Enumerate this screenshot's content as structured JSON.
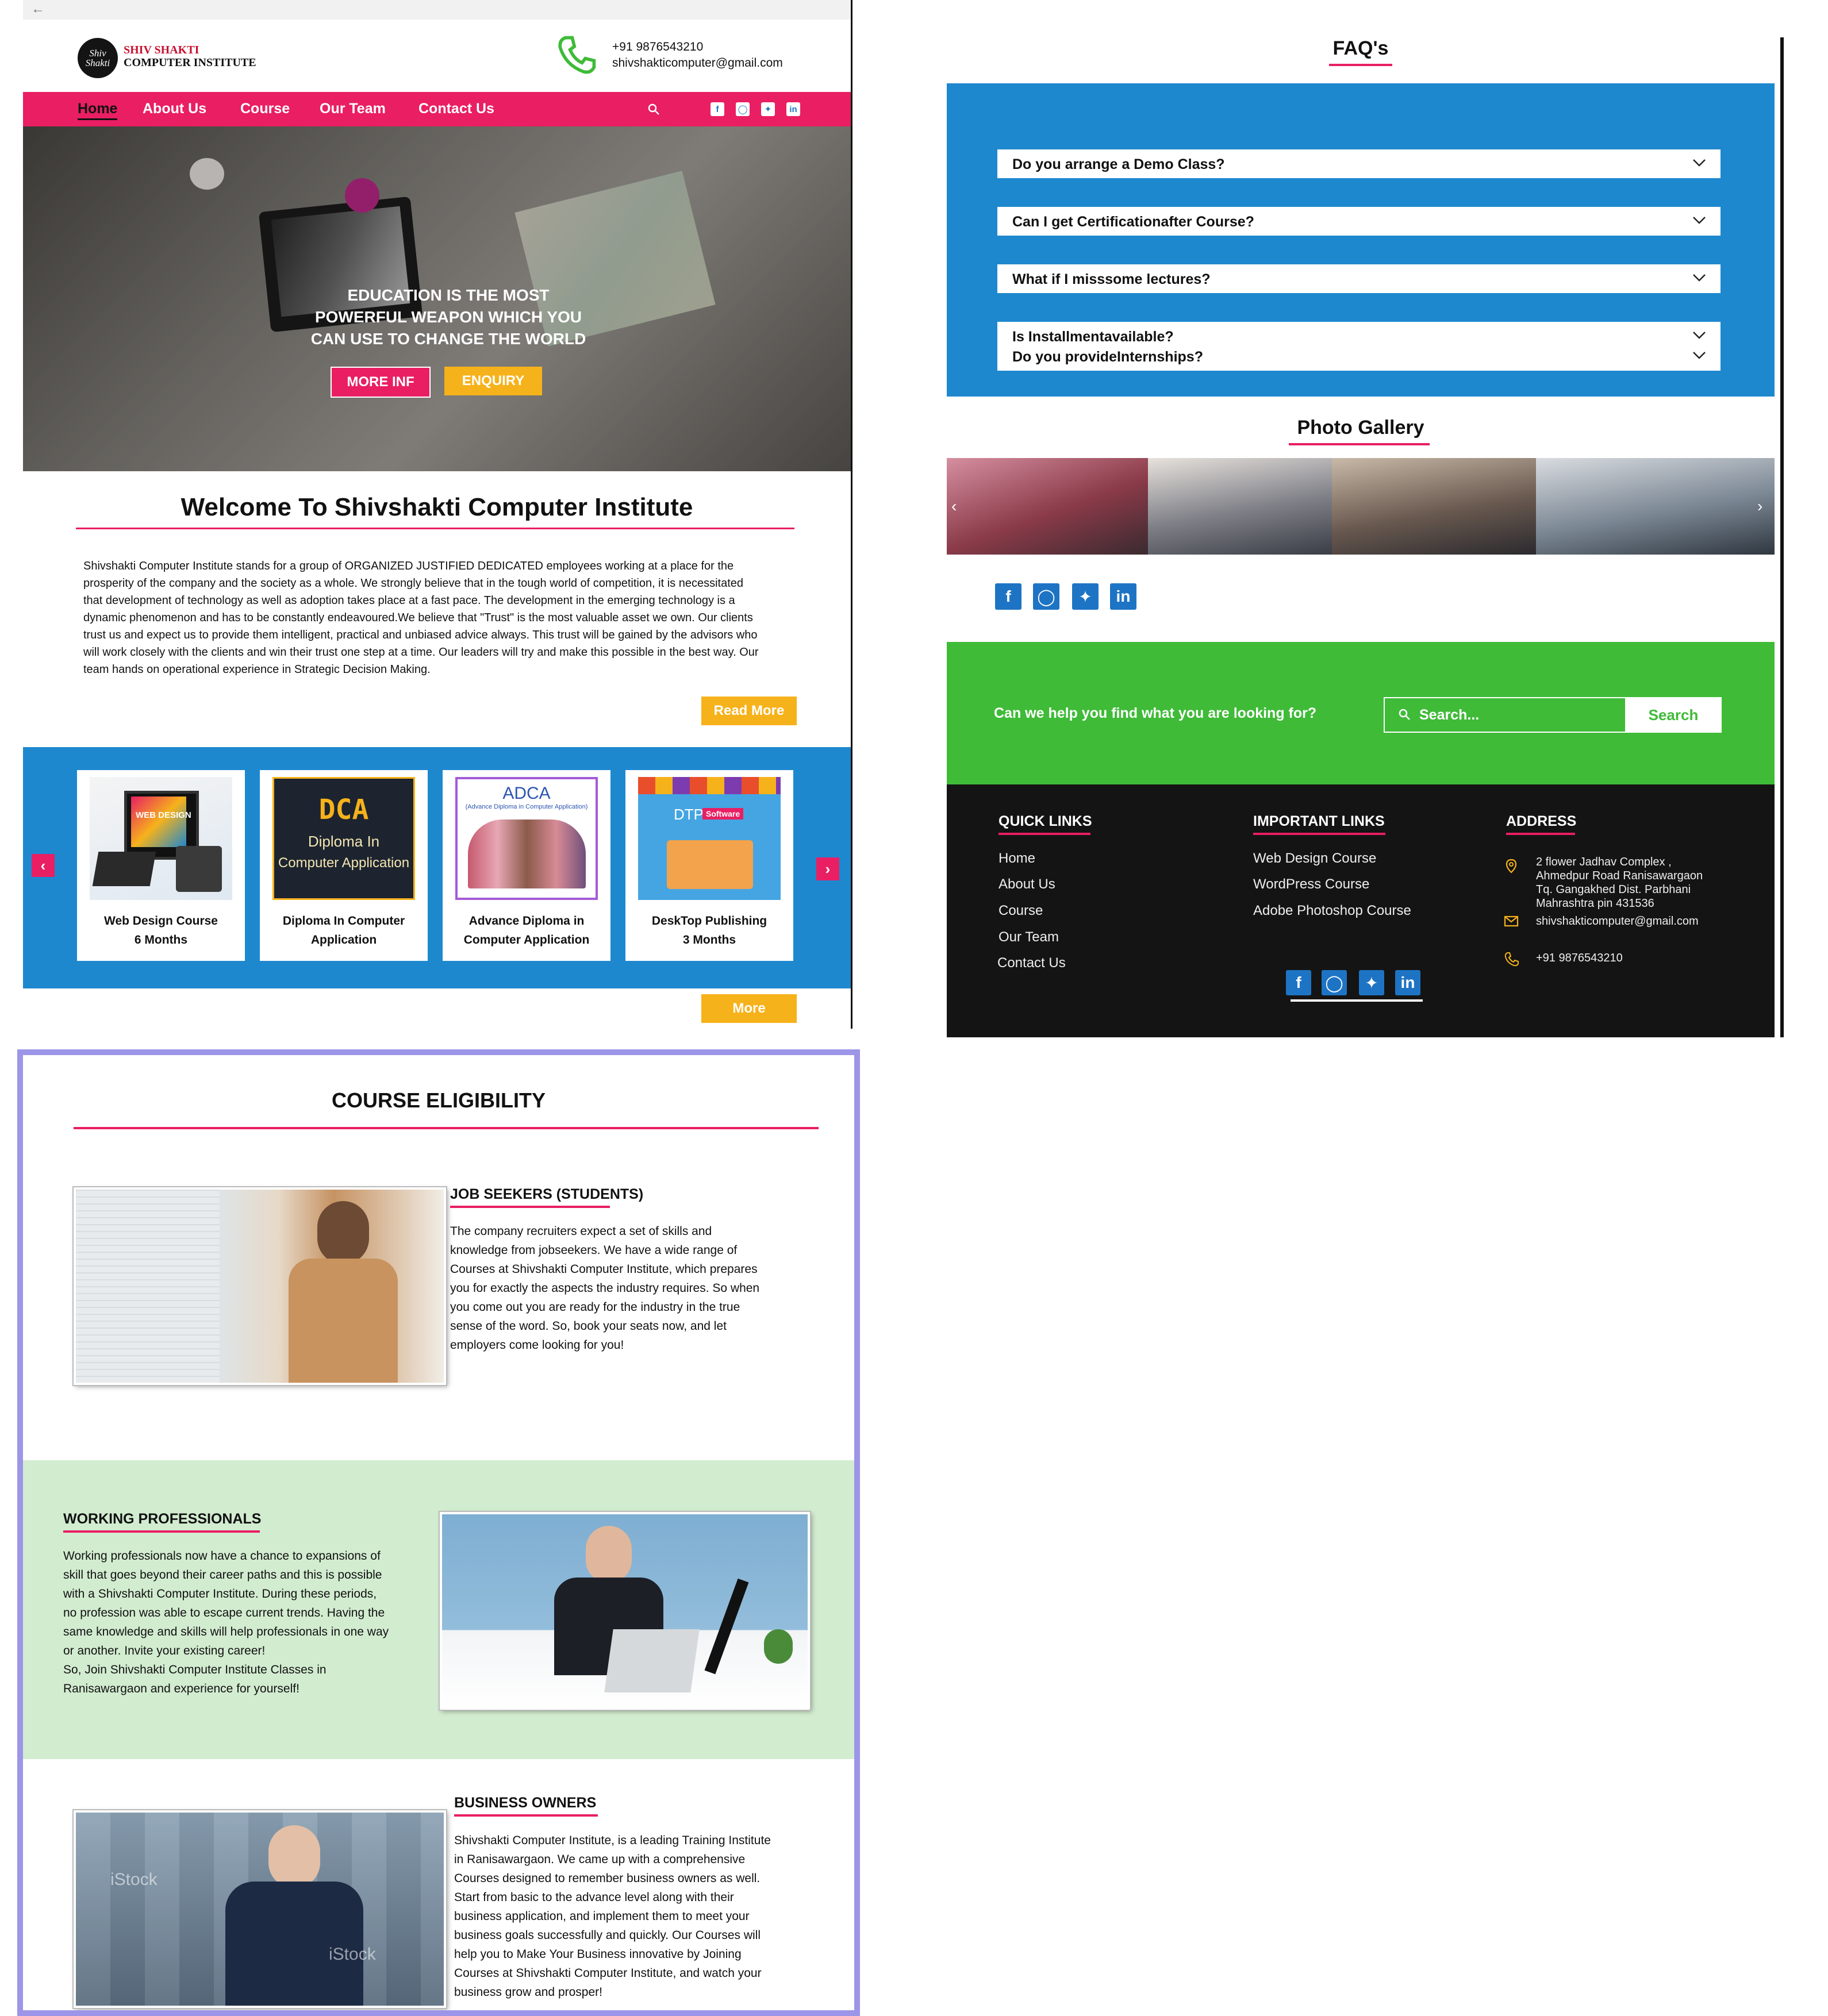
{
  "home": {
    "logo": {
      "line1": "SHIV SHAKTI",
      "line2": "COMPUTER INSTITUTE",
      "mark": "Shiv Shakti"
    },
    "contact": {
      "phone": "+91 9876543210",
      "email": "shivshakticomputer@gmail.com"
    },
    "nav": [
      "Home",
      "About Us",
      "Course",
      "Our Team",
      "Contact Us"
    ],
    "social": [
      "facebook-icon",
      "instagram-icon",
      "twitter-icon",
      "linkedin-icon"
    ],
    "hero": {
      "line1": "EDUCATION IS THE MOST",
      "line2": "POWERFUL WEAPON WHICH YOU",
      "line3": "CAN USE TO CHANGE THE WORLD",
      "btn_more": "MORE INF",
      "btn_enquiry": "ENQUIRY"
    },
    "welcome": {
      "title": "Welcome To  Shivshakti Computer Institute",
      "text": "Shivshakti Computer Institute stands for a group of ORGANIZED JUSTIFIED DEDICATED employees working at a place for the prosperity of the company and the society as a whole. We strongly believe that in the tough world of competition, it is necessitated that development of technology as well as adoption takes place at a fast pace. The development in the emerging technology is a dynamic phenomenon and has to be constantly endeavoured.We believe that \"Trust\" is the most valuable asset we own. Our clients trust us and expect us to provide them intelligent, practical and unbiased advice always. This trust will be gained by the advisors who will work closely with the clients and win their trust one step at a time. Our leaders will try and make this possible in the best way. Our team hands on operational experience in Strategic Decision Making.",
      "read_more": "Read More"
    },
    "courses": [
      {
        "line1": "Web Design Course",
        "line2": "6 Months",
        "img": "WEB DESIGN"
      },
      {
        "line1": "Diploma In Computer",
        "line2": "Application",
        "img1": "DCA",
        "img2": "Diploma In",
        "img3": "Computer Application"
      },
      {
        "line1": "Advance Diploma in",
        "line2": "Computer Application",
        "img1": "ADCA",
        "img2": "(Advance Diploma in Computer Application)"
      },
      {
        "line1": "DeskTop Publishing",
        "line2": "3 Months",
        "img1": "DTP",
        "img2": "Software"
      }
    ],
    "more_btn": "More"
  },
  "faq": {
    "title": "FAQ's",
    "items": [
      "Do you arrange a Demo Class?",
      "Can I get Certificationafter Course?",
      "What if I misssome lectures?",
      "Is Installmentavailable?",
      "Do you provideInternships?"
    ],
    "gallery_title": "Photo Gallery",
    "help_text": "Can we help you find what you are looking for?",
    "search_placeholder": "Search...",
    "search_btn": "Search",
    "footer": {
      "quick_title": "QUICK LINKS",
      "quick": [
        "Home",
        "About Us",
        "Course",
        "Our Team",
        "Contact Us"
      ],
      "important_title": "IMPORTANT LINKS",
      "important": [
        "Web Design Course",
        "WordPress Course",
        "Adobe Photoshop Course"
      ],
      "address_title": "ADDRESS",
      "address": [
        "2 flower Jadhav Complex ,",
        "Ahmedpur Road Ranisawargaon",
        "Tq. Gangakhed Dist. Parbhani",
        "Mahrashtra pin 431536"
      ],
      "email": "shivshakticomputer@gmail.com",
      "phone": "+91  9876543210"
    }
  },
  "eligibility": {
    "title": "COURSE ELIGIBILITY",
    "job": {
      "title": "JOB SEEKERS (STUDENTS)",
      "lines": [
        "The company recruiters expect a set of skills and",
        "knowledge from jobseekers. We have a wide range of",
        "Courses at Shivshakti Computer Institute, which prepares",
        "you for exactly the aspects the industry requires. So when",
        "you come out you are ready for the industry in the true",
        "sense of the word. So, book your seats now, and let",
        "employers come looking for you!"
      ]
    },
    "work": {
      "title": "WORKING PROFESSIONALS",
      "lines": [
        "Working professionals now have a chance to expansions of",
        "skill that goes beyond their career paths and this is possible",
        "with a Shivshakti Computer Institute. During these periods,",
        "no profession was able to escape current trends. Having the",
        "same knowledge and skills will help professionals in one way",
        "or another. Invite your existing career!",
        "So, Join Shivshakti Computer Institute Classes in",
        "Ranisawargaon and experience for yourself!"
      ]
    },
    "business": {
      "title": "BUSINESS OWNERS",
      "lines": [
        "Shivshakti Computer Institute, is a leading Training Institute",
        "in Ranisawargaon. We came up with a comprehensive",
        "Courses designed to remember business owners as well.",
        "Start from basic to the advance level along with their",
        "business application, and implement them to meet your",
        "business goals successfully and quickly. Our Courses will",
        "help you to Make Your Business innovative by Joining",
        "Courses at Shivshakti Computer Institute, and watch your",
        "business grow and prosper!"
      ],
      "watermark": "iStock"
    }
  },
  "colors": {
    "pink": "#e91e63",
    "blue": "#1e88cf",
    "yellow": "#f6b21b",
    "green": "#3fbb38",
    "dark": "#141414",
    "frame": "#9c95e8"
  }
}
